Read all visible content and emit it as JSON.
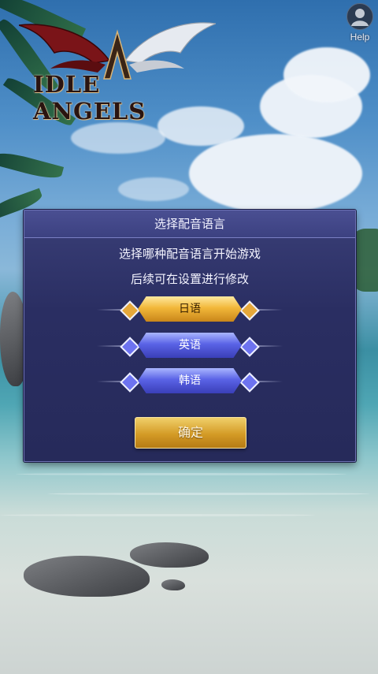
{
  "app": {
    "logo_text": "IDLE ANGELS",
    "help_label": "Help"
  },
  "dialog": {
    "title": "选择配音语言",
    "line1": "选择哪种配音语言开始游戏",
    "line2": "后续可在设置进行修改",
    "options": [
      {
        "label": "日语",
        "selected": true
      },
      {
        "label": "英语",
        "selected": false
      },
      {
        "label": "韩语",
        "selected": false
      }
    ],
    "confirm_label": "确定"
  },
  "colors": {
    "selected_option": "#f2b83a",
    "unselected_option": "#5a63e6",
    "dialog_bg": "#2a2e62",
    "confirm_button": "#d49b26"
  },
  "icons": [
    "help-avatar-icon",
    "angel-wings-logo"
  ]
}
